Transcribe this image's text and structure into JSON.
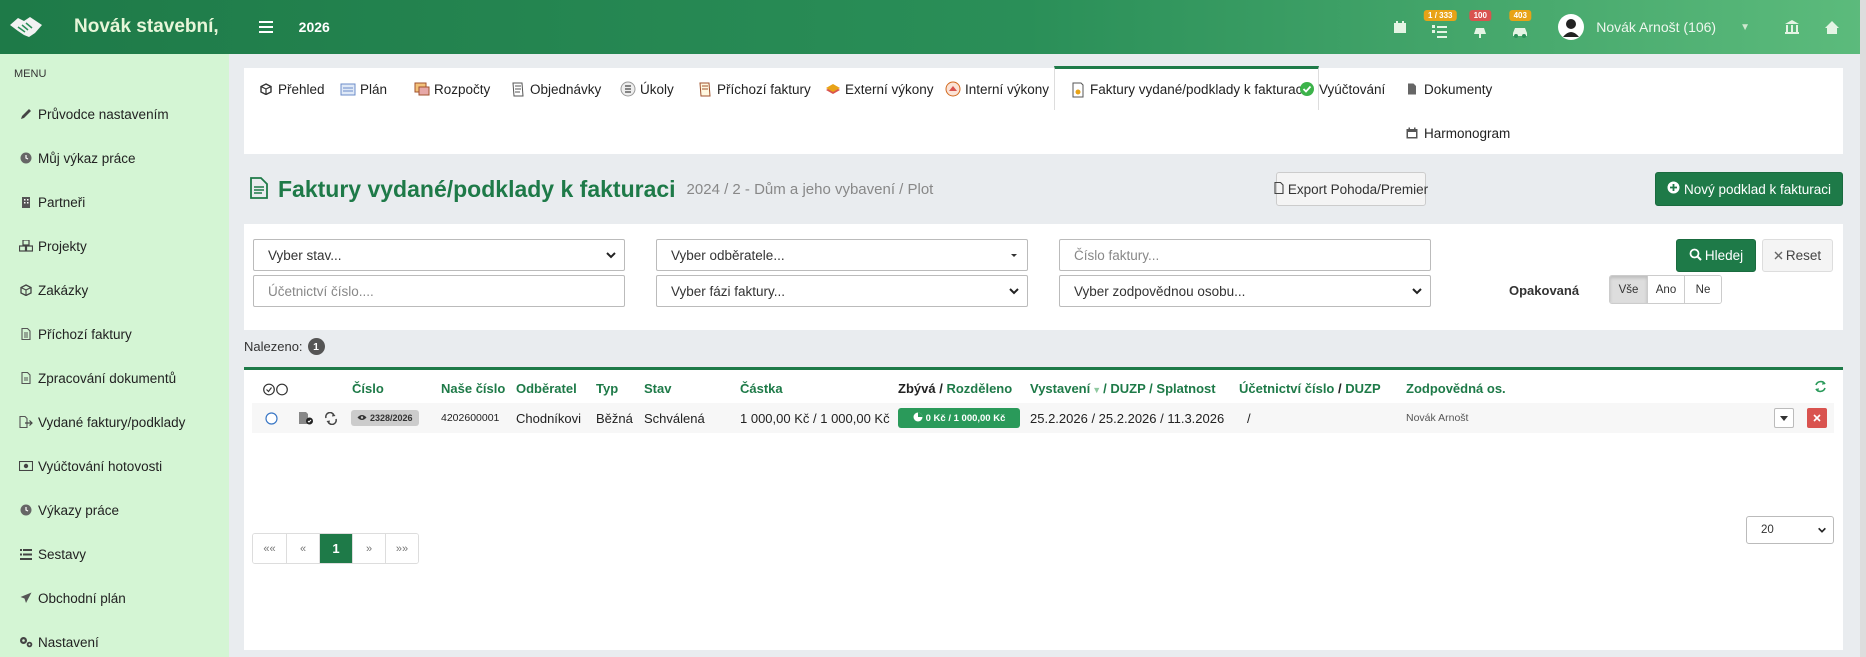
{
  "colors": {
    "brand": "#1e7a48",
    "sidebar": "#d4f5d4",
    "danger": "#d9534f",
    "badge_orange": "#e8a317",
    "badge_red": "#d9534f"
  },
  "header": {
    "brand": "Novák stavební,",
    "year": "2026",
    "badges": {
      "tasks": "1 / 333",
      "notifications": "100",
      "cars": "403"
    },
    "user": "Novák Arnošt (106)"
  },
  "sidebar": {
    "heading": "MENU",
    "items": [
      {
        "label": "Průvodce nastavením",
        "icon": "pencil-icon"
      },
      {
        "label": "Můj výkaz práce",
        "icon": "clock-icon"
      },
      {
        "label": "Partneři",
        "icon": "building-icon"
      },
      {
        "label": "Projekty",
        "icon": "cubes-icon"
      },
      {
        "label": "Zakázky",
        "icon": "cube-icon"
      },
      {
        "label": "Příchozí faktury",
        "icon": "file-icon"
      },
      {
        "label": "Zpracování dokumentů",
        "icon": "document-icon"
      },
      {
        "label": "Vydané faktury/podklady",
        "icon": "export-icon"
      },
      {
        "label": "Vyúčtování hotovosti",
        "icon": "money-icon"
      },
      {
        "label": "Výkazy práce",
        "icon": "clock-icon"
      },
      {
        "label": "Sestavy",
        "icon": "list-icon"
      },
      {
        "label": "Obchodní plán",
        "icon": "send-icon"
      },
      {
        "label": "Nastavení",
        "icon": "cogs-icon"
      }
    ]
  },
  "tabs": [
    {
      "label": "Přehled"
    },
    {
      "label": "Plán"
    },
    {
      "label": "Rozpočty"
    },
    {
      "label": "Objednávky"
    },
    {
      "label": "Úkoly"
    },
    {
      "label": "Příchozí faktury"
    },
    {
      "label": "Externí výkony"
    },
    {
      "label": "Interní výkony"
    },
    {
      "label": "Faktury vydané/podklady k fakturaci"
    },
    {
      "label": "Vyúčtování"
    },
    {
      "label": "Dokumenty"
    },
    {
      "label": "Harmonogram"
    }
  ],
  "page": {
    "title": "Faktury vydané/podklady k fakturaci",
    "subtitle": "2024 / 2 - Dům a jeho vybavení / Plot",
    "export_label": "Export Pohoda/Premier",
    "new_label": "Nový podklad k fakturaci"
  },
  "filters": {
    "state_ph": "Vyber stav...",
    "customer_ph": "Vyber odběratele...",
    "invoice_no_ph": "Číslo faktury...",
    "accounting_no_ph": "Účetnictví číslo....",
    "phase_ph": "Vyber fázi faktury...",
    "person_ph": "Vyber zodpovědnou osobu...",
    "search_label": "Hledej",
    "reset_label": "Reset",
    "repeated_label": "Opakovaná",
    "repeated_options": [
      "Vše",
      "Ano",
      "Ne"
    ]
  },
  "results": {
    "label": "Nalezeno:",
    "count": "1"
  },
  "table": {
    "headers": {
      "number": "Číslo",
      "our_number": "Naše číslo",
      "customer": "Odběratel",
      "type": "Typ",
      "state": "Stav",
      "amount": "Částka",
      "remains": "Zbývá",
      "slash1": "/",
      "distributed": "Rozděleno",
      "issued": "Vystavení",
      "duzp": "/ DUZP",
      "maturity": "/ Splatnost",
      "accounting": "Účetnictví číslo",
      "accounting_duzp": "DUZP",
      "responsible": "Zodpovědná os."
    },
    "rows": [
      {
        "number": "2328/2026",
        "our_number": "4202600001",
        "customer": "Chodníkovi",
        "type": "Běžná",
        "state": "Schválená",
        "amount": "1 000,00 Kč / 1 000,00 Kč",
        "remains": "0 Kč / 1 000,00 Kč",
        "dates": "25.2.2026 / 25.2.2026 / 11.3.2026",
        "accounting": "/",
        "responsible": "Novák Arnošt"
      }
    ]
  },
  "pagination": {
    "first": "««",
    "prev": "«",
    "current": "1",
    "next": "»",
    "last": "»»",
    "per_page": "20"
  }
}
